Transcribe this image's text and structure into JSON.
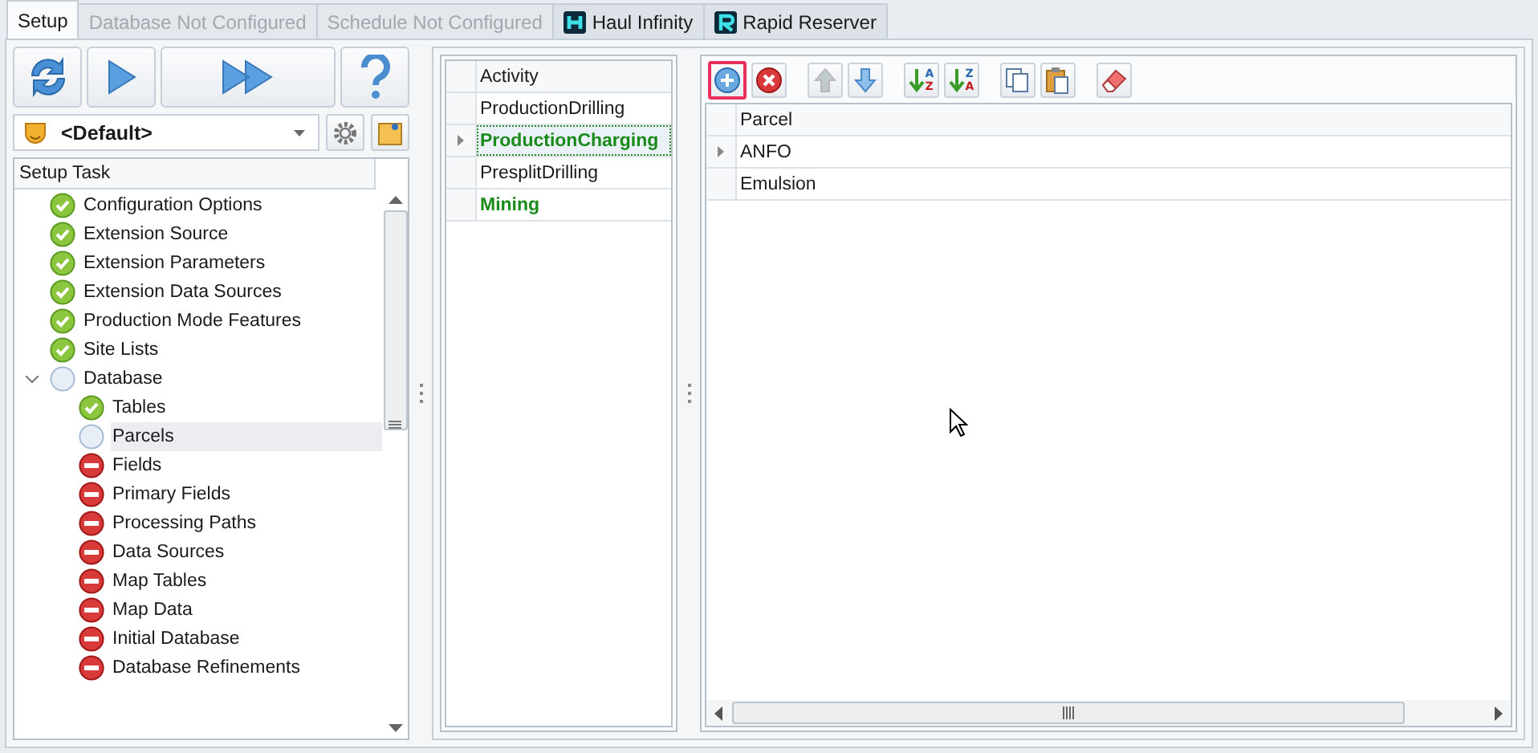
{
  "tabs": [
    {
      "label": "Setup",
      "selected": true,
      "disabled": false,
      "kind": "plain"
    },
    {
      "label": "Database Not Configured",
      "selected": false,
      "disabled": true,
      "kind": "plain"
    },
    {
      "label": "Schedule Not Configured",
      "selected": false,
      "disabled": true,
      "kind": "plain"
    },
    {
      "label": "Haul Infinity",
      "selected": false,
      "disabled": false,
      "kind": "haul"
    },
    {
      "label": "Rapid Reserver",
      "selected": false,
      "disabled": false,
      "kind": "reserver"
    }
  ],
  "profile": {
    "value": "<Default>"
  },
  "setup_tree": {
    "header": "Setup Task",
    "items": [
      {
        "label": "Configuration Options",
        "kind": "done",
        "selected": false
      },
      {
        "label": "Extension Source",
        "kind": "done",
        "selected": false
      },
      {
        "label": "Extension Parameters",
        "kind": "done",
        "selected": false
      },
      {
        "label": "Extension Data Sources",
        "kind": "done",
        "selected": false
      },
      {
        "label": "Production Mode Features",
        "kind": "done",
        "selected": false
      },
      {
        "label": "Site Lists",
        "kind": "done",
        "selected": false
      },
      {
        "label": "Database",
        "kind": "pending",
        "selected": false,
        "expanded": true,
        "children": [
          {
            "label": "Tables",
            "kind": "done",
            "selected": false
          },
          {
            "label": "Parcels",
            "kind": "pending",
            "selected": true
          },
          {
            "label": "Fields",
            "kind": "error",
            "selected": false
          },
          {
            "label": "Primary Fields",
            "kind": "error",
            "selected": false
          },
          {
            "label": "Processing Paths",
            "kind": "error",
            "selected": false
          },
          {
            "label": "Data Sources",
            "kind": "error",
            "selected": false
          },
          {
            "label": "Map Tables",
            "kind": "error",
            "selected": false
          },
          {
            "label": "Map Data",
            "kind": "error",
            "selected": false
          },
          {
            "label": "Initial Database",
            "kind": "error",
            "selected": false
          },
          {
            "label": "Database Refinements",
            "kind": "error",
            "selected": false
          }
        ]
      }
    ]
  },
  "activities": {
    "column": "Activity",
    "rows": [
      {
        "name": "ProductionDrilling",
        "selected": false,
        "highlighted": false
      },
      {
        "name": "ProductionCharging",
        "selected": true,
        "highlighted": true
      },
      {
        "name": "PresplitDrilling",
        "selected": false,
        "highlighted": false
      },
      {
        "name": "Mining",
        "selected": false,
        "highlighted": true
      }
    ]
  },
  "parcel_toolbar": [
    {
      "kind": "add",
      "disabled": false,
      "focused": true
    },
    {
      "kind": "delete",
      "disabled": false,
      "focused": false
    },
    {
      "kind": "up",
      "disabled": true,
      "focused": false
    },
    {
      "kind": "down",
      "disabled": false,
      "focused": false
    },
    {
      "kind": "sort-asc",
      "disabled": false,
      "focused": false,
      "letters": [
        "A",
        "Z"
      ]
    },
    {
      "kind": "sort-desc",
      "disabled": false,
      "focused": false,
      "letters": [
        "Z",
        "A"
      ]
    },
    {
      "kind": "copy",
      "disabled": false,
      "focused": false
    },
    {
      "kind": "paste",
      "disabled": false,
      "focused": false
    },
    {
      "kind": "erase",
      "disabled": false,
      "focused": false
    }
  ],
  "parcels": {
    "column": "Parcel",
    "rows": [
      {
        "name": "ANFO",
        "selected": true
      },
      {
        "name": "Emulsion",
        "selected": false
      }
    ]
  }
}
